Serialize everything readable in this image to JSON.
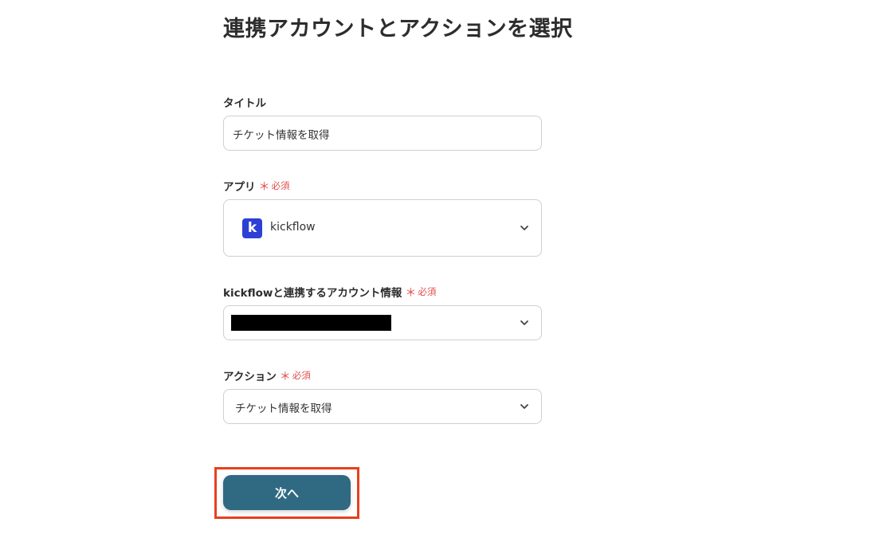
{
  "page": {
    "title": "連携アカウントとアクションを選択"
  },
  "form": {
    "title_field": {
      "label": "タイトル",
      "value": "チケット情報を取得"
    },
    "app_field": {
      "label": "アプリ",
      "required_mark": "＊",
      "required_text": "必須",
      "selected_app": "kickflow",
      "logo_letter": "k",
      "logo_color": "#2e3fd6"
    },
    "account_field": {
      "label": "kickflowと連携するアカウント情報",
      "required_mark": "＊",
      "required_text": "必須",
      "value_redacted": true
    },
    "action_field": {
      "label": "アクション",
      "required_mark": "＊",
      "required_text": "必須",
      "value": "チケット情報を取得"
    }
  },
  "next_button": {
    "label": "次へ",
    "color": "#2f6a82",
    "highlight_color": "#e8401c"
  },
  "icons": {
    "dropdown": "chevron-down-icon"
  }
}
